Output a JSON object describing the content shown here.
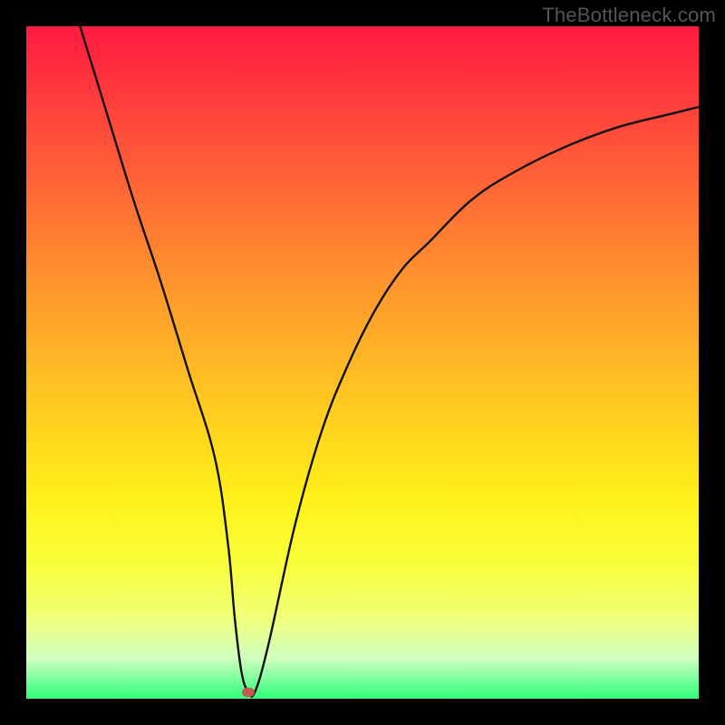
{
  "watermark": "TheBottleneck.com",
  "chart_data": {
    "type": "line",
    "title": "",
    "xlabel": "",
    "ylabel": "",
    "xlim": [
      0,
      100
    ],
    "ylim": [
      0,
      100
    ],
    "grid": false,
    "legend": false,
    "marker": {
      "x": 33,
      "y": 1
    },
    "series": [
      {
        "name": "curve",
        "x": [
          8,
          12,
          16,
          20,
          24,
          28,
          30,
          31,
          32,
          33,
          34,
          36,
          40,
          44,
          48,
          52,
          56,
          60,
          66,
          72,
          80,
          88,
          96,
          100
        ],
        "values": [
          100,
          87,
          74,
          62,
          49,
          36,
          23,
          12,
          4,
          1,
          1,
          8,
          26,
          40,
          50,
          58,
          64,
          68,
          74,
          78,
          82,
          85,
          87,
          88
        ]
      }
    ]
  },
  "colors": {
    "curve_stroke": "#111111",
    "marker_fill": "#c65a52"
  }
}
